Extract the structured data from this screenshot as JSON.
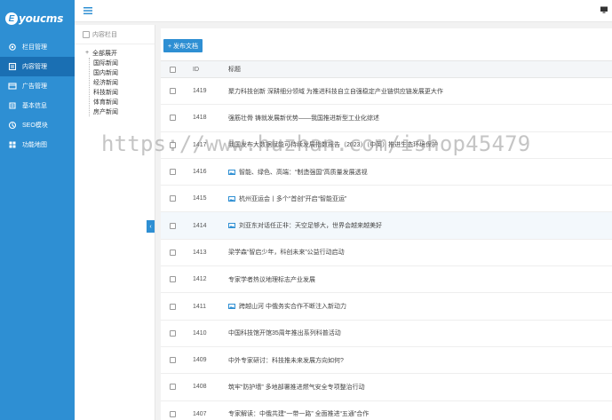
{
  "app": {
    "logo_letter": "E",
    "logo_text": "youcms"
  },
  "sidebar": {
    "items": [
      {
        "label": "栏目管理",
        "icon": "settings-gear-icon",
        "active": false
      },
      {
        "label": "内容管理",
        "icon": "content-icon",
        "active": true
      },
      {
        "label": "广告管理",
        "icon": "ad-icon",
        "active": false
      },
      {
        "label": "基本信息",
        "icon": "info-icon",
        "active": false
      },
      {
        "label": "SEO模块",
        "icon": "seo-icon",
        "active": false
      },
      {
        "label": "功能地图",
        "icon": "map-icon",
        "active": false
      }
    ]
  },
  "tree": {
    "header": "内容栏目",
    "root": "全部展开",
    "children": [
      "国际新闻",
      "国内新闻",
      "经济新闻",
      "科技新闻",
      "体育新闻",
      "房产新闻"
    ]
  },
  "main": {
    "add_button": "+ 发布文档",
    "columns": {
      "id": "ID",
      "title": "标题"
    },
    "rows": [
      {
        "id": "1419",
        "title": "聚力科技创新 深耕细分领域 为推进科技自立自强稳定产业链供应链发展更大作",
        "img": false
      },
      {
        "id": "1418",
        "title": "强筋壮骨 铸就发展新优势——我国推进新型工业化综述",
        "img": false
      },
      {
        "id": "1417",
        "title": "我国发布大数据赋能可持续发展指数报告（2023）（中英）推进生态环境保护",
        "img": false
      },
      {
        "id": "1416",
        "title": "智能、绿色、高端：“制造强国”高质量发展透视",
        "img": true
      },
      {
        "id": "1415",
        "title": "杭州亚运会丨多个“首创”开启“智能亚运”",
        "img": true
      },
      {
        "id": "1414",
        "title": "刘亚东对话任正非：天空足够大，世界会越来越美好",
        "img": true
      },
      {
        "id": "1413",
        "title": "梁学森“智启少年，科创未来”公益行动启动",
        "img": false
      },
      {
        "id": "1412",
        "title": "专家学者热议地理标志产业发展",
        "img": false
      },
      {
        "id": "1411",
        "title": "跨越山河 中俄务实合作不断注入新动力",
        "img": true
      },
      {
        "id": "1410",
        "title": "中国科技馆开馆35周年推出系列科普活动",
        "img": false
      },
      {
        "id": "1409",
        "title": "中外专家研讨：科技推未来发展方向如何?",
        "img": false
      },
      {
        "id": "1408",
        "title": "筑牢“防护墙” 多地部署推进燃气安全专项整治行动",
        "img": false
      },
      {
        "id": "1407",
        "title": "专家解读：中俄共建“一带一路” 全面推进“五通”合作",
        "img": false
      }
    ]
  },
  "watermark": "https://www.huzhan.com/ishop45479",
  "colors": {
    "primary": "#2e8fd3",
    "sidebar_active": "#1a6fb3"
  }
}
